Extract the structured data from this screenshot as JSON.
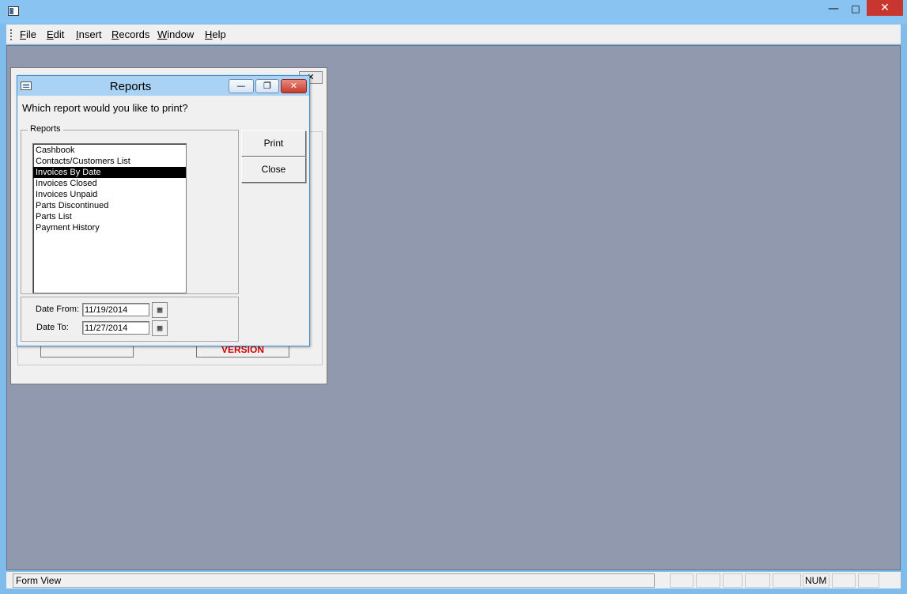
{
  "menu": {
    "items": [
      {
        "label": "File"
      },
      {
        "label": "Edit"
      },
      {
        "label": "Insert"
      },
      {
        "label": "Records"
      },
      {
        "label": "Window"
      },
      {
        "label": "Help"
      }
    ]
  },
  "background_form": {
    "version_text": "VERSION"
  },
  "dialog": {
    "title": "Reports",
    "prompt": "Which report would you like to print?",
    "reports_group_label": "Reports",
    "reports": [
      {
        "label": "Cashbook"
      },
      {
        "label": "Contacts/Customers List"
      },
      {
        "label": "Invoices By Date"
      },
      {
        "label": "Invoices Closed"
      },
      {
        "label": "Invoices Unpaid"
      },
      {
        "label": "Parts Discontinued"
      },
      {
        "label": "Parts List"
      },
      {
        "label": "Payment History"
      }
    ],
    "selected_report": "Invoices By Date",
    "print_label": "Print",
    "close_label": "Close",
    "date_from_label": "Date From:",
    "date_from_value": "11/19/2014",
    "date_to_label": "Date To:",
    "date_to_value": "11/27/2014"
  },
  "status_bar": {
    "mode": "Form View",
    "num_indicator": "NUM"
  },
  "icons": {
    "app": "app-window-icon",
    "dialog": "form-icon",
    "calendar": "calendar-icon"
  }
}
